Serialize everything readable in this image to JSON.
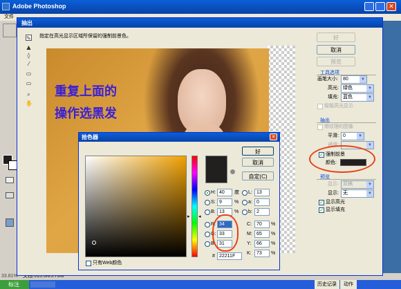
{
  "app": {
    "title": "Adobe Photoshop",
    "menu_first": "文件",
    "zoom": "33.81%",
    "doc_status": "文档:915.5K/5.70M",
    "taskbar_start": "标注",
    "palette_tabs": [
      "历史记录",
      "动作"
    ]
  },
  "extract": {
    "title": "抽出",
    "hint": "指定在高光显示区域所保留的强制前景色。",
    "buttons": {
      "ok": "好",
      "cancel": "取消",
      "preview": "预览"
    },
    "tool_options": {
      "title": "工具选项",
      "brush_size_label": "画笔大小:",
      "brush_size_value": "80",
      "highlight_label": "高光:",
      "highlight_value": "绿色",
      "fill_label": "填充:",
      "fill_value": "蓝色",
      "smart_highlight": "智能高光显示"
    },
    "extraction": {
      "title": "抽出",
      "textured_image": "带纹理的图像",
      "smooth_label": "平滑:",
      "smooth_value": "0",
      "channel_label": "通道:",
      "force_fg_label": "强制前景",
      "force_fg_checked": true,
      "color_label": "颜色:",
      "color_swatch": "#221f1f"
    },
    "preview_section": {
      "title": "预览",
      "show_label": "显示:",
      "show_value": "原稿",
      "display_label": "显示:",
      "display_value": "无",
      "show_highlight": "显示高光",
      "show_fill": "显示填充"
    },
    "canvas_text": [
      "重复上面的",
      "操作选黑发"
    ]
  },
  "picker": {
    "title": "拾色器",
    "buttons": {
      "ok": "好",
      "cancel": "取消",
      "custom": "自定(C)"
    },
    "hsb": [
      {
        "label": "H:",
        "value": "40",
        "unit": "度"
      },
      {
        "label": "S:",
        "value": "9",
        "unit": "%"
      },
      {
        "label": "B:",
        "value": "13",
        "unit": "%"
      }
    ],
    "rgb": [
      {
        "label": "R:",
        "value": "34"
      },
      {
        "label": "G:",
        "value": "33"
      },
      {
        "label": "B:",
        "value": "31"
      }
    ],
    "lab": [
      {
        "label": "L:",
        "value": "13"
      },
      {
        "label": "a:",
        "value": "0"
      },
      {
        "label": "b:",
        "value": "2"
      }
    ],
    "cmyk": [
      {
        "label": "C:",
        "value": "70",
        "unit": "%"
      },
      {
        "label": "M:",
        "value": "65",
        "unit": "%"
      },
      {
        "label": "Y:",
        "value": "66",
        "unit": "%"
      },
      {
        "label": "K:",
        "value": "73",
        "unit": "%"
      }
    ],
    "hex_label": "#",
    "hex_value": "22211F",
    "web_only": "只有Web颜色",
    "hue_color": "#f0a000",
    "new_color": "#221f1f"
  },
  "colors": {
    "xp_blue": "#0a246a",
    "dialog_bg": "#ece9d8",
    "annotation_red": "#e8401a",
    "annotation_text": "#3a1fd6"
  }
}
